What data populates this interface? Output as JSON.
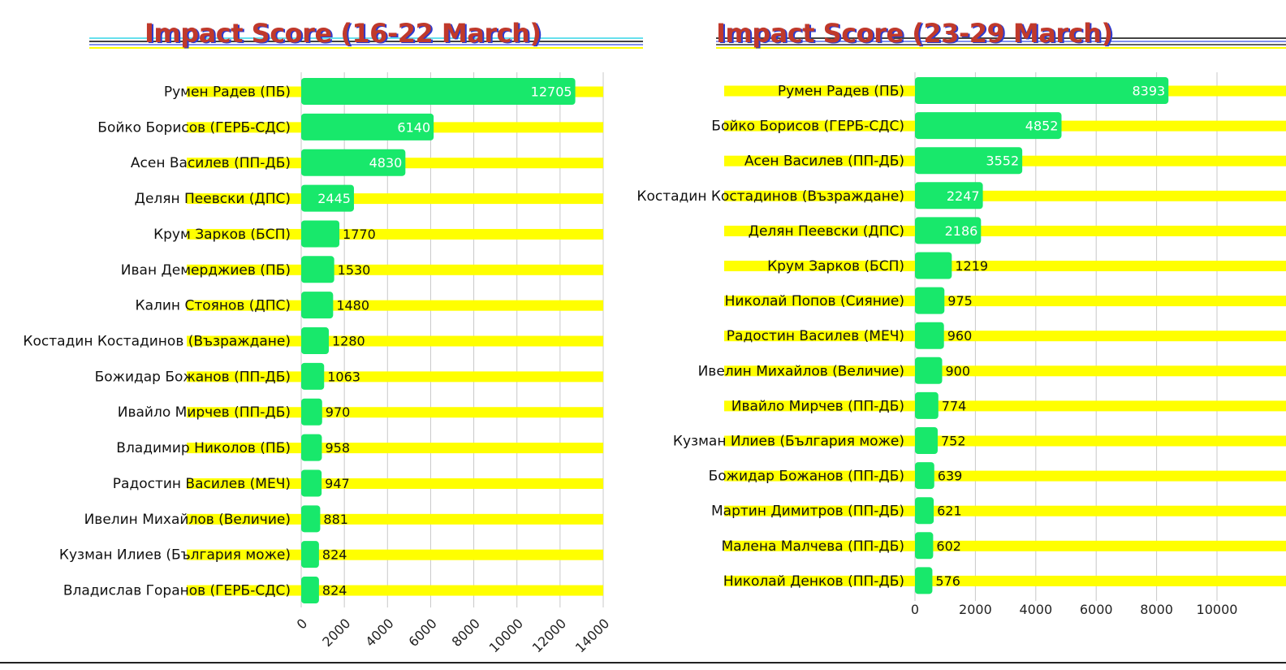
{
  "colors": {
    "bar": "#18e86b",
    "stripe": "#ffff00",
    "grid": "#c8c8c8",
    "title": "#c0392b",
    "title_shadow": "#2b3bd1",
    "value_inside": "#ffffff",
    "value_outside": "#111111",
    "label_green": "#1aa84c"
  },
  "chart_data": [
    {
      "type": "bar",
      "orientation": "horizontal",
      "title": "Impact Score (16-22 March)",
      "xlabel": "",
      "ylabel": "",
      "xlim": [
        0,
        14000
      ],
      "xticks": [
        "0",
        "2000",
        "4000",
        "6000",
        "8000",
        "10000",
        "12000",
        "14000"
      ],
      "xtick_rotation": "diagonal",
      "grid": true,
      "categories": [
        "Румен Радев (ПБ)",
        "Бойко Борисов (ГЕРБ-СДС)",
        "Асен Василев (ПП-ДБ)",
        "Делян Пеевски (ДПС)",
        "Крум Зарков (БСП)",
        "Иван Демерджиев (ПБ)",
        "Калин Стоянов (ДПС)",
        "Костадин Костадинов (Възраждане)",
        "Божидар Божанов (ПП-ДБ)",
        "Ивайло Мирчев (ПП-ДБ)",
        "Владимир Николов (ПБ)",
        "Радостин Василев (МЕЧ)",
        "Ивелин Михайлов (Величие)",
        "Кузман Илиев (България може)",
        "Владислав Горанов (ГЕРБ-СДС)"
      ],
      "values": [
        12705,
        6140,
        4830,
        2445,
        1770,
        1530,
        1480,
        1280,
        1063,
        970,
        958,
        947,
        881,
        824,
        824
      ],
      "value_labels": [
        "12705",
        "6140",
        "4830",
        "2445",
        "1770",
        "1530",
        "1480",
        "1280",
        "1063",
        "970",
        "958",
        "947",
        "881",
        "824",
        "824"
      ]
    },
    {
      "type": "bar",
      "orientation": "horizontal",
      "title": "Impact Score (23-29 March)",
      "xlabel": "",
      "ylabel": "",
      "xlim": [
        0,
        10000
      ],
      "xticks": [
        "0",
        "2000",
        "4000",
        "6000",
        "8000",
        "10000"
      ],
      "xtick_rotation": "horizontal",
      "grid": true,
      "categories": [
        "Румен Радев (ПБ)",
        "Бойко Борисов (ГЕРБ-СДС)",
        "Асен Василев (ПП-ДБ)",
        "Костадин Костадинов (Възраждане)",
        "Делян Пеевски (ДПС)",
        "Крум Зарков (БСП)",
        "Николай Попов (Сияние)",
        "Радостин Василев (МЕЧ)",
        "Ивелин Михайлов (Величие)",
        "Ивайло Мирчев (ПП-ДБ)",
        "Кузман Илиев (България може)",
        "Божидар Божанов (ПП-ДБ)",
        "Мартин Димитров (ПП-ДБ)",
        "Малена Малчева (ПП-ДБ)",
        "Николай Денков (ПП-ДБ)"
      ],
      "values": [
        8393,
        4852,
        3552,
        2247,
        2186,
        1219,
        975,
        960,
        900,
        774,
        752,
        639,
        621,
        602,
        576
      ],
      "value_labels": [
        "8393",
        "4852",
        "3552",
        "2247",
        "2186",
        "1219",
        "975",
        "960",
        "900",
        "774",
        "752",
        "639",
        "621",
        "602",
        "576"
      ]
    }
  ]
}
